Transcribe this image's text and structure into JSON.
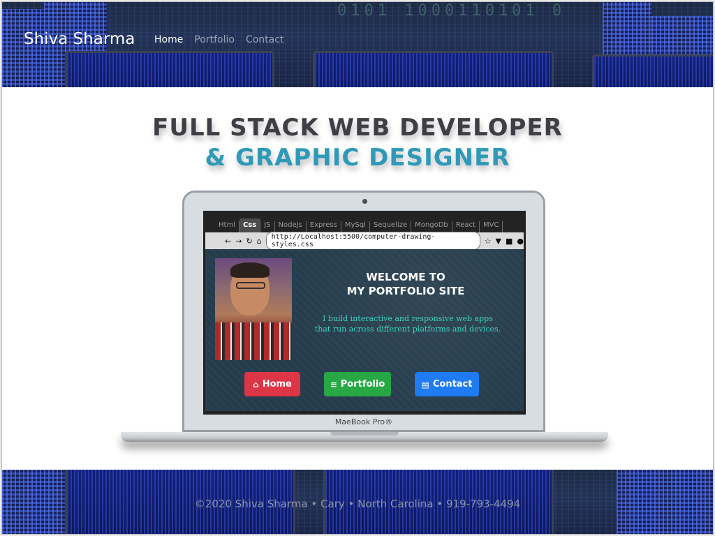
{
  "header": {
    "brand": "Shiva Sharma",
    "nav": [
      {
        "label": "Home",
        "active": true
      },
      {
        "label": "Portfolio",
        "active": false
      },
      {
        "label": "Contact",
        "active": false
      }
    ],
    "binary_text": "0101 1000110101 0"
  },
  "hero": {
    "line1": "FULL STACK WEB DEVELOPER",
    "line2": "& GRAPHIC DESIGNER",
    "line2_color": "#2f9ab8"
  },
  "laptop": {
    "model": "MaeBook Pro®",
    "browser": {
      "tabs": [
        "Html",
        "Css",
        "JS",
        "NodeJs",
        "Express",
        "MySql",
        "Sequelize",
        "MongoDb",
        "React",
        "MVC"
      ],
      "active_tab": "Css",
      "url": "http://Localhost:5500/computer-drawing-styles.css",
      "nav_icons": [
        "back-arrow-icon",
        "forward-arrow-icon",
        "reload-icon",
        "home-icon"
      ],
      "toolbar_icons": [
        "star-icon",
        "pocket-icon",
        "folder-icon",
        "user-icon"
      ]
    },
    "site": {
      "welcome_line1": "WELCOME TO",
      "welcome_line2": "MY PORTFOLIO SITE",
      "intro_line1": "I build interactive and responsive web apps",
      "intro_line2": "that run across different platforms and devices.",
      "buttons": {
        "home": "Home",
        "portfolio": "Portfolio",
        "contact": "Contact"
      },
      "button_colors": {
        "home": "#dc3545",
        "portfolio": "#28a745",
        "contact": "#1e7bf2"
      }
    }
  },
  "footer": {
    "copyright": "©2020 Shiva Sharma • Cary • North Carolina • 919-793-4494"
  }
}
